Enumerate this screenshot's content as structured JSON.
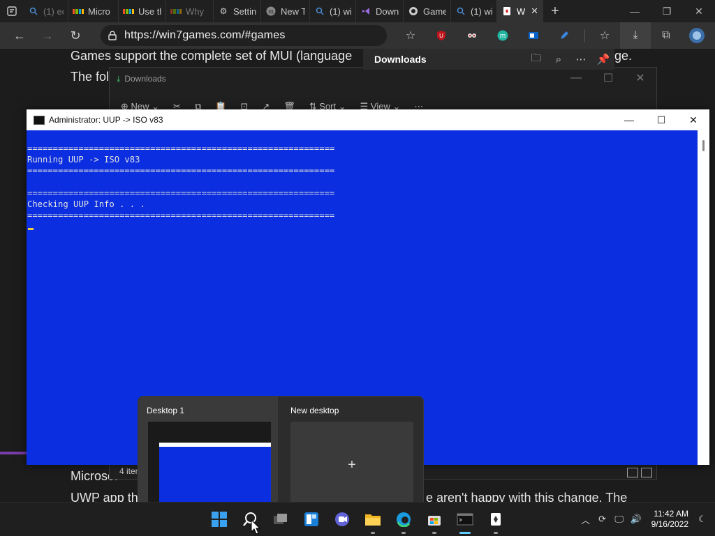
{
  "browser": {
    "tabs": [
      {
        "label": "(1) eo",
        "icon": "search-icon"
      },
      {
        "label": "Micro",
        "icon": "microsoft-logo-icon"
      },
      {
        "label": "Use th",
        "icon": "microsoft-logo-icon"
      },
      {
        "label": "Why",
        "icon": "microsoft-logo-icon"
      },
      {
        "label": "Settin",
        "icon": "gear-icon"
      },
      {
        "label": "New T",
        "icon": "m-logo-icon"
      },
      {
        "label": "(1) wi",
        "icon": "search-icon"
      },
      {
        "label": "Down",
        "icon": "visual-studio-icon"
      },
      {
        "label": "Game",
        "icon": "github-icon"
      },
      {
        "label": "(1) wi",
        "icon": "search-icon"
      },
      {
        "label": "W",
        "icon": "solitaire-icon",
        "active": true
      }
    ],
    "url": "https://win7games.com/#games"
  },
  "page": {
    "line1": "Games support the complete set of MUI (language",
    "line1_end": "ge.",
    "line2": "The fol",
    "line3": "Microsof",
    "line4": "UWP app th",
    "line4_end": "e aren't happy with this change. The"
  },
  "downloads_flyout": {
    "title": "Downloads"
  },
  "explorer": {
    "title": "Downloads",
    "commands": [
      "New",
      "Sort",
      "View"
    ],
    "status": "4 iter"
  },
  "console": {
    "title": "Administrator:  UUP -> ISO v83",
    "lines": [
      "============================================================",
      "Running UUP -> ISO v83",
      "============================================================",
      "",
      "============================================================",
      "Checking UUP Info . . .",
      "============================================================"
    ]
  },
  "taskview": {
    "desktop1": "Desktop 1",
    "new_desktop": "New desktop",
    "add_symbol": "+"
  },
  "taskbar": {
    "time": "11:42 AM",
    "date": "9/16/2022"
  },
  "colors": {
    "console_bg": "#0a2ee0",
    "accent": "#60cdff"
  }
}
